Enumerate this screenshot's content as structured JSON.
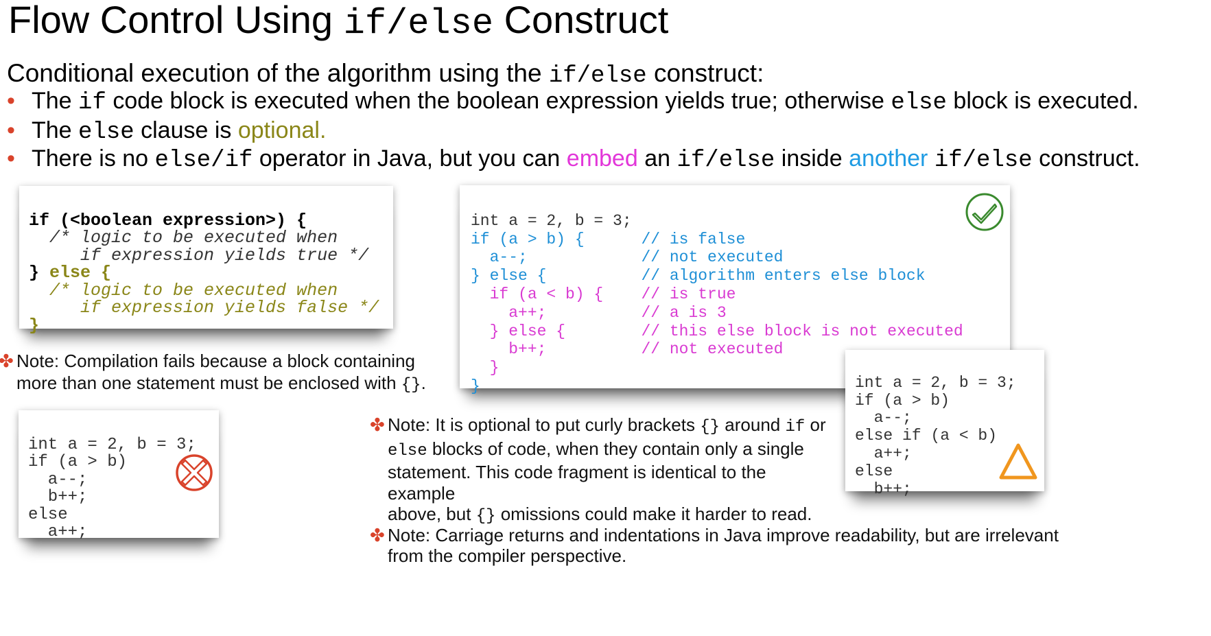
{
  "title": {
    "part1": "Flow Control Using",
    "code": "if/else",
    "part2": "Construct"
  },
  "intro": {
    "part1": "Conditional execution of the algorithm using the",
    "code": "if/else",
    "part2": "construct:"
  },
  "bullets": {
    "b1": {
      "t1": "The",
      "c1": "if",
      "t2": "code block is executed when the boolean expression yields true; otherwise",
      "c2": "else",
      "t3": "block is executed."
    },
    "b2": {
      "t1": "The",
      "c1": "else",
      "t2": "clause is",
      "t3": "optional."
    },
    "b3": {
      "t1": "There is no",
      "c1": "else/if",
      "t2": "operator in Java, but you can",
      "t3": "embed",
      "t4": "an",
      "c2": "if/else",
      "t5": "inside",
      "t6": "another",
      "c3": "if/else",
      "t7": "construct."
    }
  },
  "syntax_box": {
    "l1": "if (<boolean expression>) {",
    "l2": "  /* logic to be executed when",
    "l3": "     if expression yields true */",
    "l4a": "} ",
    "l4b": "else {",
    "l5": "  /* logic to be executed when",
    "l6": "     if expression yields false */",
    "l7": "}"
  },
  "nested_box": {
    "l1": "int a = 2, b = 3;",
    "l2": "if (a > b) {      // is false",
    "l3": "  a--;            // not executed",
    "l4": "} else {          // algorithm enters else block",
    "l5": "  if (a < b) {    // is true",
    "l6": "    a++;          // a is 3",
    "l7": "  } else {        // this else block is not executed",
    "l8": "    b++;          // not executed",
    "l9": "  }",
    "l10": "}"
  },
  "fail_box": {
    "l1": "int a = 2, b = 3;",
    "l2": "if (a > b)",
    "l3": "  a--;",
    "l4": "  b++;",
    "l5": "else",
    "l6": "  a++;"
  },
  "warn_box": {
    "l1": "int a = 2, b = 3;",
    "l2": "if (a > b)",
    "l3": "  a--;",
    "l4": "else if (a < b)",
    "l5": "  a++;",
    "l6": "else",
    "l7": "  b++;"
  },
  "notes": {
    "n1": {
      "t1": "Note: Compilation fails because a block containing",
      "t2": "more than one statement must be enclosed with",
      "c1": "{}",
      "t3": "."
    },
    "n2": {
      "t1": "Note: It is optional to put curly brackets",
      "c1": "{}",
      "t2": "around",
      "c2": "if",
      "t3": "or",
      "c3": "else",
      "t4": "blocks of code, when they contain only a single",
      "t5": "statement. This code fragment is identical to the example",
      "t6": "above, but",
      "c4": "{}",
      "t7": "omissions could make it harder to read."
    },
    "n3": {
      "t1": "Note: Carriage returns and indentations in Java improve readability, but are irrelevant",
      "t2": "from the compiler perspective."
    }
  },
  "note_marker": "✤",
  "bullet_marker": "•",
  "icons": {
    "success": "check-circle-icon",
    "error": "cross-circle-icon",
    "warning": "warning-triangle-icon"
  },
  "colors": {
    "accent_red": "#d9432b",
    "olive": "#8a8618",
    "magenta": "#e236d9",
    "blue": "#1e9be3",
    "check_green": "#3a8a2e",
    "warn_orange": "#f0961e"
  }
}
